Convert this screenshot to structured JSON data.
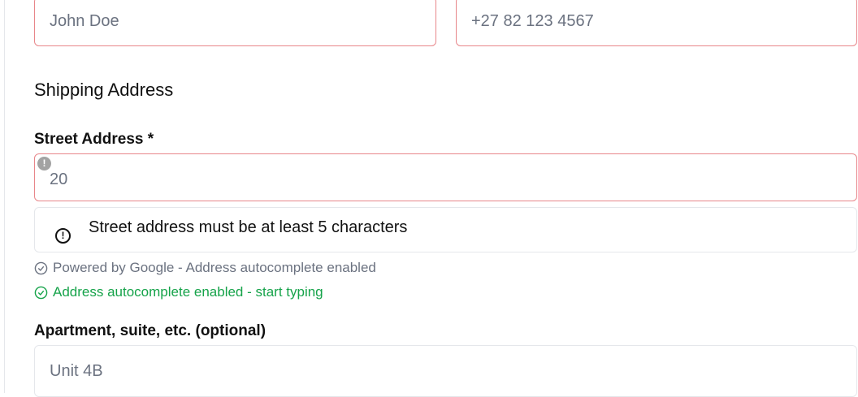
{
  "contact": {
    "name_placeholder": "John Doe",
    "phone_placeholder": "+27 82 123 4567"
  },
  "shipping": {
    "title": "Shipping Address",
    "street_label": "Street Address *",
    "street_value": "20",
    "street_warning_glyph": "!",
    "error_message": "Street address must be at least 5 characters",
    "error_glyph": "!",
    "hint_powered": "Powered by Google - Address autocomplete enabled",
    "hint_autocomplete": "Address autocomplete enabled - start typing",
    "apt_label": "Apartment, suite, etc. (optional)",
    "apt_placeholder": "Unit 4B"
  },
  "colors": {
    "error_border": "#e8868a",
    "hint_gray": "#6b7280",
    "hint_green": "#16a34a"
  }
}
